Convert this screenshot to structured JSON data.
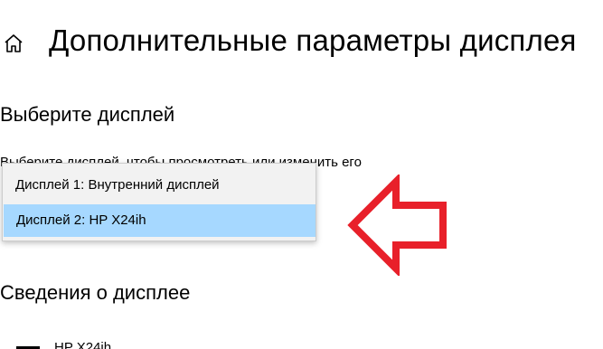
{
  "header": {
    "home_icon": "home-icon",
    "title": "Дополнительные параметры дисплея"
  },
  "select_display": {
    "heading": "Выберите дисплей",
    "hint": "Выберите дисплей, чтобы просмотреть или изменить его",
    "options": [
      {
        "label": "Дисплей 1: Внутренний дисплей",
        "selected": false
      },
      {
        "label": "Дисплей 2: HP X24ih",
        "selected": true
      }
    ]
  },
  "display_info": {
    "heading": "Сведения о дисплее",
    "monitor_name": "HP X24ih"
  },
  "annotation": {
    "arrow_icon": "red-arrow-left-icon",
    "arrow_color": "#e8202a"
  },
  "colors": {
    "selected_option_bg": "#a6d8ff",
    "dropdown_bg": "#f2f2f2"
  }
}
